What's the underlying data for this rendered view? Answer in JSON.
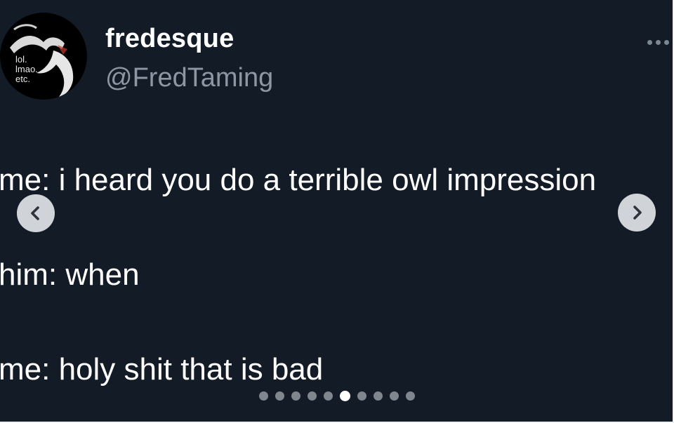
{
  "author": {
    "display_name": "fredesque",
    "handle": "@FredTaming",
    "avatar_text": [
      "lol.",
      "lmao.",
      "etc."
    ]
  },
  "tweet": {
    "lines": [
      "me: i heard you do a terrible owl impression",
      "him: when",
      "me: holy shit that is bad"
    ]
  },
  "icons": {
    "more": "more-icon",
    "prev": "chevron-left-icon",
    "next": "chevron-right-icon"
  },
  "carousel": {
    "total": 10,
    "active_index": 5
  },
  "colors": {
    "background": "#131b27",
    "text": "#ffffff",
    "handle": "#8d97a3",
    "dot_inactive": "#7f868e",
    "dot_active": "#ffffff"
  }
}
